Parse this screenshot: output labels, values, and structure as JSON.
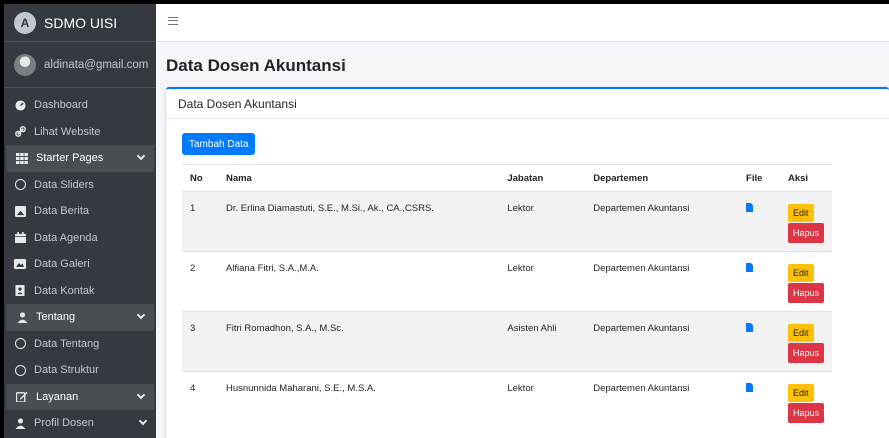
{
  "brand": {
    "name": "SDMO UISI"
  },
  "user": {
    "email": "aldinata@gmail.com"
  },
  "sidebar": {
    "items": [
      {
        "label": "Dashboard",
        "icon": "dashboard-icon"
      },
      {
        "label": "Lihat Website",
        "icon": "link-icon"
      },
      {
        "label": "Starter Pages",
        "icon": "grid-icon"
      },
      {
        "label": "Data Sliders",
        "icon": "circle-icon"
      },
      {
        "label": "Data Berita",
        "icon": "image-icon"
      },
      {
        "label": "Data Agenda",
        "icon": "calendar-icon"
      },
      {
        "label": "Data Galeri",
        "icon": "gallery-icon"
      },
      {
        "label": "Data Kontak",
        "icon": "contact-icon"
      },
      {
        "label": "Tentang",
        "icon": "user-icon"
      },
      {
        "label": "Data Tentang",
        "icon": "circle-icon"
      },
      {
        "label": "Data Struktur",
        "icon": "circle-icon"
      },
      {
        "label": "Layanan",
        "icon": "edit-icon"
      },
      {
        "label": "Profil Dosen",
        "icon": "user-icon"
      }
    ]
  },
  "page": {
    "title": "Data Dosen Akuntansi"
  },
  "card": {
    "title": "Data Dosen Akuntansi",
    "add_button": "Tambah Data"
  },
  "table": {
    "headers": {
      "no": "No",
      "nama": "Nama",
      "jabatan": "Jabatan",
      "departemen": "Departemen",
      "file": "File",
      "aksi": "Aksi"
    },
    "edit_label": "Edit",
    "delete_label": "Hapus",
    "rows": [
      {
        "no": "1",
        "nama": "Dr. Erlina Diamastuti, S.E., M.Si., Ak., CA.,CSRS.",
        "jabatan": "Lektor",
        "departemen": "Departemen Akuntansi"
      },
      {
        "no": "2",
        "nama": "Alfiana Fitri, S.A.,M.A.",
        "jabatan": "Lektor",
        "departemen": "Departemen Akuntansi"
      },
      {
        "no": "3",
        "nama": "Fitri Romadhon, S.A., M.Sc.",
        "jabatan": "Asisten Ahli",
        "departemen": "Departemen Akuntansi"
      },
      {
        "no": "4",
        "nama": "Husnunnida Maharani, S.E., M.S.A.",
        "jabatan": "Lektor",
        "departemen": "Departemen Akuntansi"
      }
    ]
  },
  "colors": {
    "primary": "#007bff",
    "warning": "#ffc107",
    "danger": "#dc3545",
    "sidebar": "#343a40"
  }
}
